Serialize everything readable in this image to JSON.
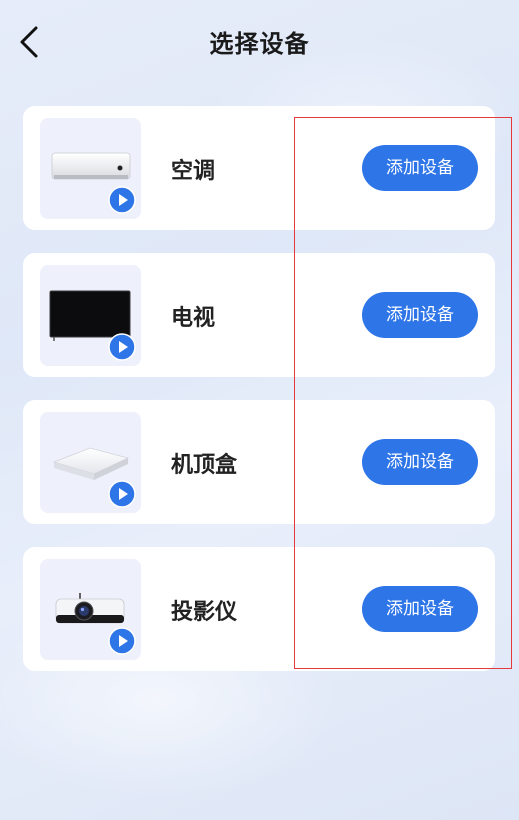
{
  "header": {
    "title": "选择设备",
    "back_icon": "chevron-left-icon"
  },
  "devices": [
    {
      "name": "空调",
      "button_label": "添加设备",
      "icon": "air-conditioner-image"
    },
    {
      "name": "电视",
      "button_label": "添加设备",
      "icon": "tv-image"
    },
    {
      "name": "机顶盒",
      "button_label": "添加设备",
      "icon": "set-top-box-image"
    },
    {
      "name": "投影仪",
      "button_label": "添加设备",
      "icon": "projector-image"
    }
  ],
  "colors": {
    "accent": "#2e75e8",
    "highlight_box": "#e53a3a",
    "card": "#ffffff",
    "thumb_bg": "#eef0fb"
  }
}
